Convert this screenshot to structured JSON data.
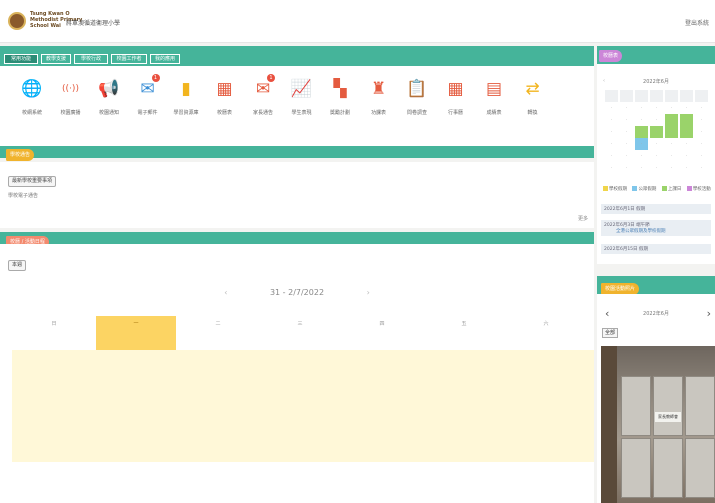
{
  "header": {
    "logo_text": [
      "Tsung Kwan O",
      "Methodist Primary",
      "School Wai"
    ],
    "site_title": "將軍澳循道衞理小學",
    "user_link": "登出系統"
  },
  "tabs": [
    "常用功能",
    "教學支援",
    "學校行政",
    "校園工作者",
    "我的應用"
  ],
  "apps": [
    {
      "label": "校網系統",
      "icon": "globe-icon",
      "glyph": "🌐",
      "color": "#e45b3f"
    },
    {
      "label": "校園廣播",
      "icon": "broadcast-icon",
      "glyph": "((·))",
      "color": "#e45b3f"
    },
    {
      "label": "校園通知",
      "icon": "megaphone-icon",
      "glyph": "📢",
      "color": "#e9b53a"
    },
    {
      "label": "電子郵件",
      "icon": "mail-icon",
      "glyph": "✉",
      "color": "#3b8fd6",
      "badge": "1"
    },
    {
      "label": "學習資源庫",
      "icon": "book-icon",
      "glyph": "▮",
      "color": "#f2b51f"
    },
    {
      "label": "校曆表",
      "icon": "calendar-icon",
      "glyph": "▦",
      "color": "#e45b3f"
    },
    {
      "label": "家長通告",
      "icon": "envelope-icon",
      "glyph": "✉",
      "color": "#e45b3f",
      "badge": "1"
    },
    {
      "label": "學生表現",
      "icon": "chart-icon",
      "glyph": "📈",
      "color": "#3b8fd6"
    },
    {
      "label": "獎勵計劃",
      "icon": "map-icon",
      "glyph": "▚",
      "color": "#e45b3f"
    },
    {
      "label": "功課表",
      "icon": "stamp-icon",
      "glyph": "♜",
      "color": "#e45b3f"
    },
    {
      "label": "問卷調查",
      "icon": "clipboard-icon",
      "glyph": "📋",
      "color": "#45b49a"
    },
    {
      "label": "行事曆",
      "icon": "calendar2-icon",
      "glyph": "▦",
      "color": "#e45b3f"
    },
    {
      "label": "成績表",
      "icon": "report-icon",
      "glyph": "▤",
      "color": "#e45b3f"
    },
    {
      "label": "轉換",
      "icon": "swap-icon",
      "glyph": "⇄",
      "color": "#f2b51f"
    }
  ],
  "notices": {
    "title": "學校通告",
    "chip": "最新學校重要事項",
    "sub": "學校電子通告",
    "more": "更多"
  },
  "schedule": {
    "title": "校曆 / 活動日程",
    "button": "本週",
    "week_label": "31 - 2/7/2022",
    "days": [
      "日",
      "一",
      "二",
      "三",
      "四",
      "五",
      "六"
    ]
  },
  "calendar": {
    "title": "校曆表",
    "month": "2022年6月",
    "legend": [
      "學校假期",
      "公眾假期",
      "上課日",
      "學校活動"
    ],
    "events": [
      {
        "date": "2022年6月1日",
        "text": "假期"
      },
      {
        "date": "2022年6月3日",
        "text": "端午節",
        "sub": "全港公眾假期及學校假期"
      },
      {
        "date": "2022年6月15日",
        "text": "假期"
      }
    ]
  },
  "photos": {
    "title": "校園活動照片",
    "nav_label": "2022年6月",
    "button": "全部",
    "caption": "家長教師會"
  },
  "colors": {
    "teal": "#45b49a",
    "notice": "#f0b32d",
    "schedule": "#f38a6e",
    "calendar": "#cc86d8",
    "highlight": "#fcd463"
  }
}
